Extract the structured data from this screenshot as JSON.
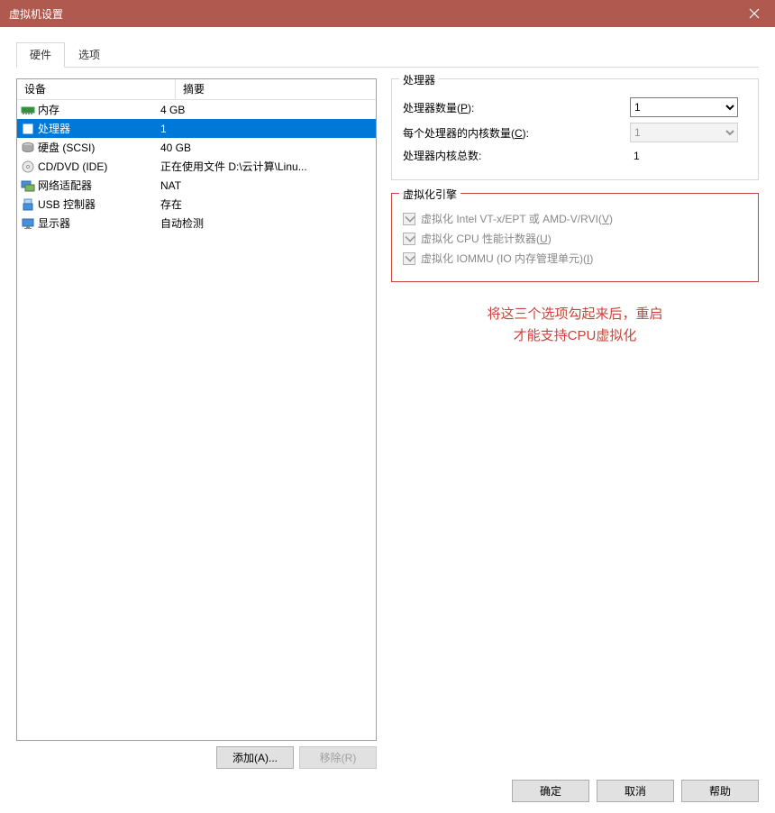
{
  "window": {
    "title": "虚拟机设置"
  },
  "tabs": {
    "hardware": "硬件",
    "options": "选项"
  },
  "list": {
    "header": {
      "device": "设备",
      "summary": "摘要"
    },
    "rows": [
      {
        "icon": "memory",
        "device": "内存",
        "summary": "4 GB"
      },
      {
        "icon": "cpu",
        "device": "处理器",
        "summary": "1"
      },
      {
        "icon": "disk",
        "device": "硬盘 (SCSI)",
        "summary": "40 GB"
      },
      {
        "icon": "cd",
        "device": "CD/DVD (IDE)",
        "summary": "正在使用文件 D:\\云计算\\Linu..."
      },
      {
        "icon": "net",
        "device": "网络适配器",
        "summary": "NAT"
      },
      {
        "icon": "usb",
        "device": "USB 控制器",
        "summary": "存在"
      },
      {
        "icon": "display",
        "device": "显示器",
        "summary": "自动检测"
      }
    ],
    "selectedIndex": 1
  },
  "buttons": {
    "add": "添加(A)...",
    "remove": "移除(R)"
  },
  "proc": {
    "group": "处理器",
    "count_label_pre": "处理器数量(",
    "count_label_u": "P",
    "count_label_post": "):",
    "count_value": "1",
    "cores_label_pre": "每个处理器的内核数量(",
    "cores_label_u": "C",
    "cores_label_post": "):",
    "cores_value": "1",
    "total_label": "处理器内核总数:",
    "total_value": "1"
  },
  "virt": {
    "group": "虚拟化引擎",
    "opt1_pre": "虚拟化 Intel VT-x/EPT 或 AMD-V/RVI(",
    "opt1_u": "V",
    "opt1_post": ")",
    "opt2_pre": "虚拟化 CPU 性能计数器(",
    "opt2_u": "U",
    "opt2_post": ")",
    "opt3_pre": "虚拟化 IOMMU (IO 内存管理单元)(",
    "opt3_u": "I",
    "opt3_post": ")"
  },
  "annotation": {
    "line1": "将这三个选项勾起来后，重启",
    "line2": "才能支持CPU虚拟化"
  },
  "footer": {
    "ok": "确定",
    "cancel": "取消",
    "help": "帮助"
  }
}
